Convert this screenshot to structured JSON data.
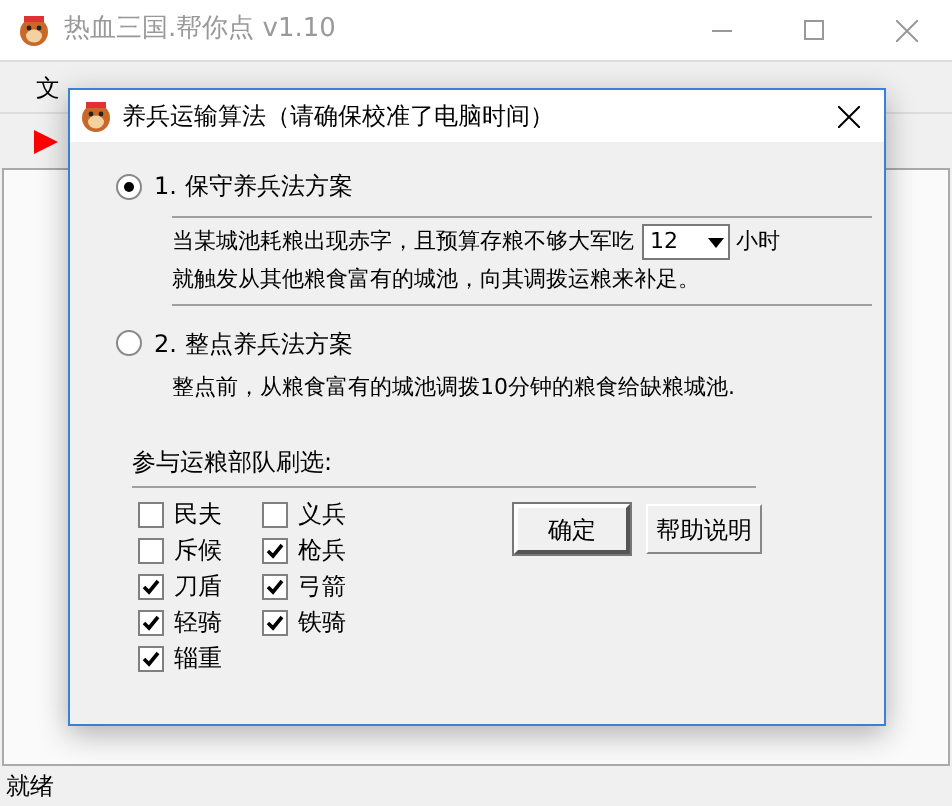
{
  "window": {
    "title": "热血三国.帮你点 v1.10"
  },
  "menu": [
    {
      "label": "文"
    }
  ],
  "status_bar": "就绪",
  "dialog": {
    "title": "养兵运输算法（请确保校准了电脑时间）",
    "options": [
      {
        "label": "1. 保守养兵法方案",
        "selected": true,
        "kind": "dropdown",
        "text_before": "当某城池耗粮出现赤字，且预算存粮不够大军吃",
        "value": "12",
        "text_after": "小时",
        "text_line2": "就触发从其他粮食富有的城池，向其调拨运粮来补足。"
      },
      {
        "label": "2. 整点养兵法方案",
        "selected": false,
        "kind": "plain",
        "text_before": "整点前，从粮食富有的城池调拨10分钟的粮食给缺粮城池."
      }
    ],
    "filter_label": "参与运粮部队刷选:",
    "units": [
      {
        "label": "民夫",
        "checked": false
      },
      {
        "label": "义兵",
        "checked": false
      },
      {
        "label": "斥候",
        "checked": false
      },
      {
        "label": "枪兵",
        "checked": true
      },
      {
        "label": "刀盾",
        "checked": true
      },
      {
        "label": "弓箭",
        "checked": true
      },
      {
        "label": "轻骑",
        "checked": true
      },
      {
        "label": "铁骑",
        "checked": true
      },
      {
        "label": "辎重",
        "checked": true
      }
    ],
    "buttons": [
      {
        "label": "确定",
        "default": true
      },
      {
        "label": "帮助说明",
        "default": false
      }
    ]
  }
}
